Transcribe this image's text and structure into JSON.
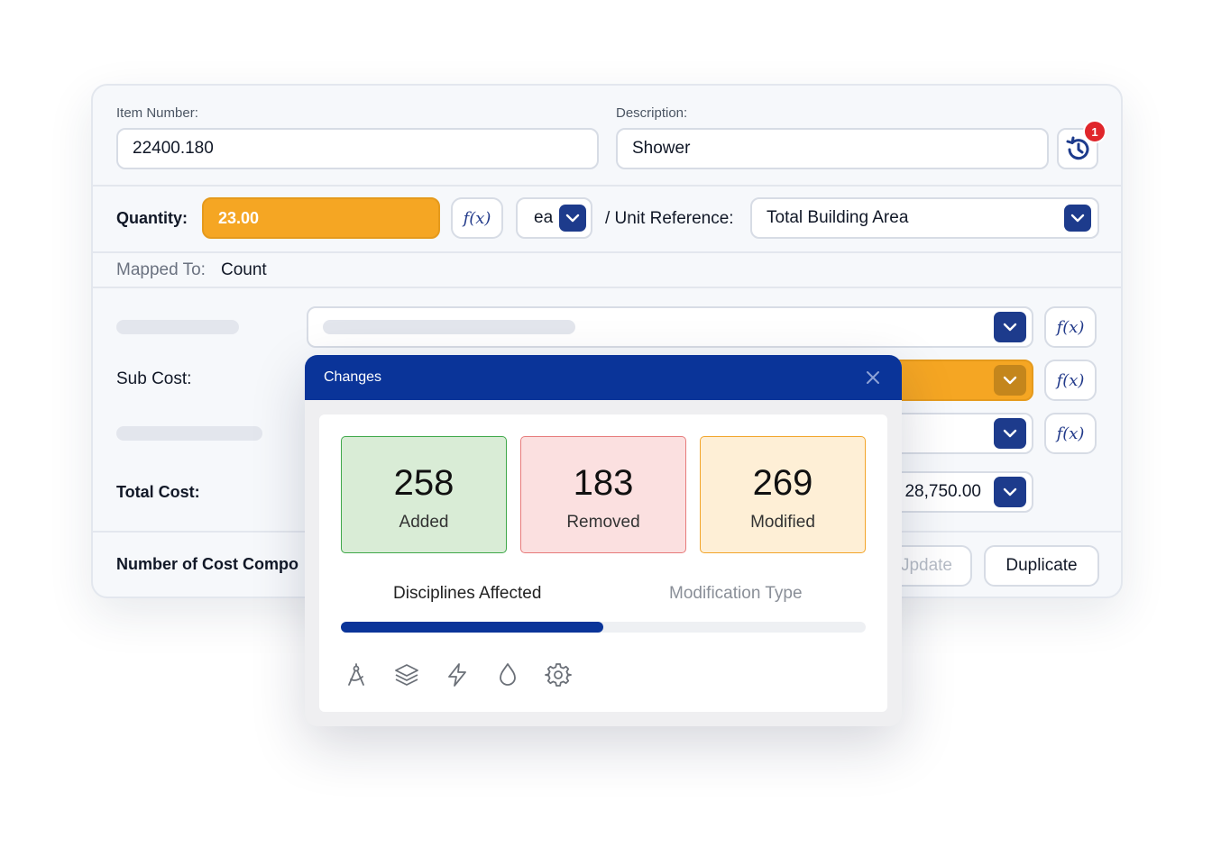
{
  "item": {
    "number_label": "Item Number:",
    "number_value": "22400.180",
    "description_label": "Description:",
    "description_value": "Shower",
    "history_badge": "1"
  },
  "quantity": {
    "label": "Quantity:",
    "value": "23.00",
    "fx_label": "f(x)",
    "unit": "ea",
    "unit_ref_label": "/ Unit Reference:",
    "unit_ref_value": "Total Building Area"
  },
  "mapped": {
    "label": "Mapped To:",
    "value": "Count"
  },
  "costs": {
    "sub_cost_label": "Sub Cost:",
    "total_cost_label": "Total Cost:",
    "total_cost_value": "28,750.00",
    "fx_label": "f(x)"
  },
  "footer": {
    "components_label": "Number of Cost Compo",
    "update_label": "Jpdate",
    "duplicate_label": "Duplicate"
  },
  "popup": {
    "title": "Changes",
    "stats": [
      {
        "value": "258",
        "label": "Added",
        "bg": "#d9ecd6",
        "border": "#3fa84a"
      },
      {
        "value": "183",
        "label": "Removed",
        "bg": "#fbe0e0",
        "border": "#e77b7b"
      },
      {
        "value": "269",
        "label": "Modified",
        "bg": "#feefd6",
        "border": "#f2a52b"
      }
    ],
    "tabs": [
      "Disciplines Affected",
      "Modification Type"
    ],
    "active_tab_progress": 0.5,
    "icons": [
      "compass-icon",
      "layers-icon",
      "lightning-icon",
      "droplet-icon",
      "gear-icon"
    ]
  },
  "colors": {
    "brand": "#0a3499",
    "accent_orange": "#f5a623",
    "badge_red": "#e0262b"
  }
}
